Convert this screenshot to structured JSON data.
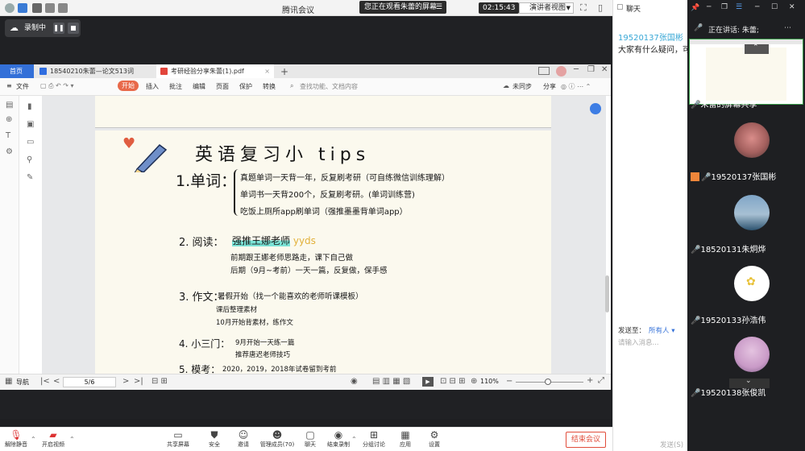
{
  "topbar": {
    "title": "腾讯会议",
    "viewing": "您正在观看朱蕾的屏幕",
    "timer": "02:15:43",
    "view_mode": "演讲者视图"
  },
  "recording": {
    "label": "录制中"
  },
  "wps": {
    "tabs": [
      {
        "label": "首页"
      },
      {
        "label": "18540210朱蕾—论文513词"
      },
      {
        "label": "考研经验分享朱蕾(1).pdf"
      }
    ],
    "ribbon": {
      "file": "文件",
      "start": "开始",
      "items": [
        "插入",
        "批注",
        "编辑",
        "页面",
        "保护",
        "转换"
      ],
      "search_placeholder": "查找功能、文档内容",
      "unsync": "未同步",
      "share": "分享"
    },
    "status": {
      "nav": "导航",
      "page": "5/6",
      "zoom": "110%"
    }
  },
  "note": {
    "title": "英语复习小 tips",
    "s1_title": "1.单词：",
    "s1_lines": [
      "真题单词一天背一年，反复刷考研（可自练微信训练理解）",
      "单词书一天背200个，反复刷考研。(单词训练营)",
      "吃饭上厕所app刷单词（强推墨墨背单词app）"
    ],
    "s2_title": "2. 阅读：",
    "s2_head": "强推王娜老师",
    "s2_tag": "yyds",
    "s2_lines": [
      "前期跟王娜老师思路走，课下自己做",
      "后期（9月~考前）一天一篇，反复做，保手感"
    ],
    "s3_title": "3. 作文：",
    "s3_lines": [
      "暑假开始（找一个能喜欢的老师听课模板）",
      "课后整理素材",
      "10月开始背素材，练作文"
    ],
    "s4_title": "4. 小三门：",
    "s4_lines": [
      "9月开始一天练一篇",
      "推荐唐迟老师技巧"
    ],
    "s5_title": "5. 模考：",
    "s5_lines": [
      "2020，2019，2018年试卷留到考前"
    ]
  },
  "toolbar": {
    "buttons": [
      {
        "label": "解除静音",
        "icon": "mic-off-icon"
      },
      {
        "label": "开启视频",
        "icon": "video-off-icon"
      },
      {
        "label": "共享屏幕",
        "icon": "share-screen-icon"
      },
      {
        "label": "安全",
        "icon": "shield-icon"
      },
      {
        "label": "邀请",
        "icon": "invite-icon"
      },
      {
        "label": "管理成员(70)",
        "icon": "members-icon"
      },
      {
        "label": "聊天",
        "icon": "chat-icon"
      },
      {
        "label": "结束录制",
        "icon": "stop-record-icon"
      },
      {
        "label": "分组讨论",
        "icon": "breakout-icon"
      },
      {
        "label": "应用",
        "icon": "apps-icon"
      },
      {
        "label": "设置",
        "icon": "gear-icon"
      }
    ],
    "end_meeting": "结束会议"
  },
  "chat": {
    "title": "聊天",
    "sender": "19520137张国彬",
    "message": "大家有什么疑问，可以",
    "send_to_label": "发送至：",
    "send_to_value": "所有人",
    "input_placeholder": "请输入消息...",
    "send_button": "发送(S)"
  },
  "videos": {
    "speaking": "正在讲话: 朱蕾;",
    "screen_label": "朱蕾的屏幕共享",
    "participants": [
      {
        "name": "19520137张国彬"
      },
      {
        "name": "18520131朱炯烨"
      },
      {
        "name": "19520133孙浩伟"
      },
      {
        "name": "19520138张俊凯"
      }
    ]
  }
}
